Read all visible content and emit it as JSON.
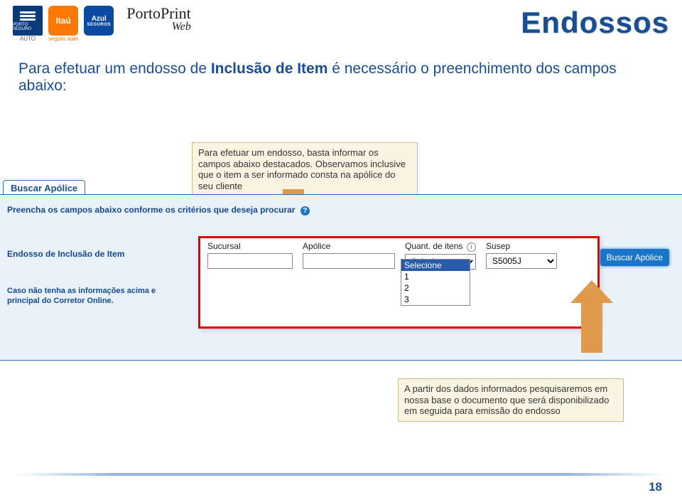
{
  "header": {
    "title_right": "Endossos",
    "portoprint": "PortoPrint",
    "portoprint_web": "Web",
    "porto_seguro_text": "PORTO SEGURO",
    "porto_seguro_sub": "AUTO",
    "itau_text": "Itaú",
    "itau_sub": "seguro auto",
    "azul_text": "Azul",
    "azul_sub": "SEGUROS"
  },
  "instruction": {
    "part1": "Para efetuar um endosso  de ",
    "bold": "Inclusão de Item",
    "part2": " é necessário o preenchimento dos campos abaixo:"
  },
  "callout1": "Para efetuar um endosso, basta informar os campos abaixo destacados. Observamos inclusive que o item a ser informado consta na apólice do seu cliente",
  "callout2": "A partir dos dados informados pesquisaremos em nossa base o documento que será disponibilizado em seguida para emissão do endosso",
  "panel": {
    "tab": "Buscar Apólice",
    "preencha": "Preencha os campos abaixo conforme os critérios que deseja procurar",
    "left_label": "Endosso de Inclusão de Item",
    "left_small1": "Caso não tenha as informações acima e",
    "left_small2": "principal do Corretor Online."
  },
  "form": {
    "sucursal_label": "Sucursal",
    "apolice_label": "Apólice",
    "quant_label": "Quant. de itens",
    "susep_label": "Susep",
    "quant_selected": "Selecione",
    "susep_value": "S5005J",
    "dropdown": [
      "Selecione",
      "1",
      "2",
      "3"
    ],
    "button": "Buscar Apólice"
  },
  "page_number": "18"
}
